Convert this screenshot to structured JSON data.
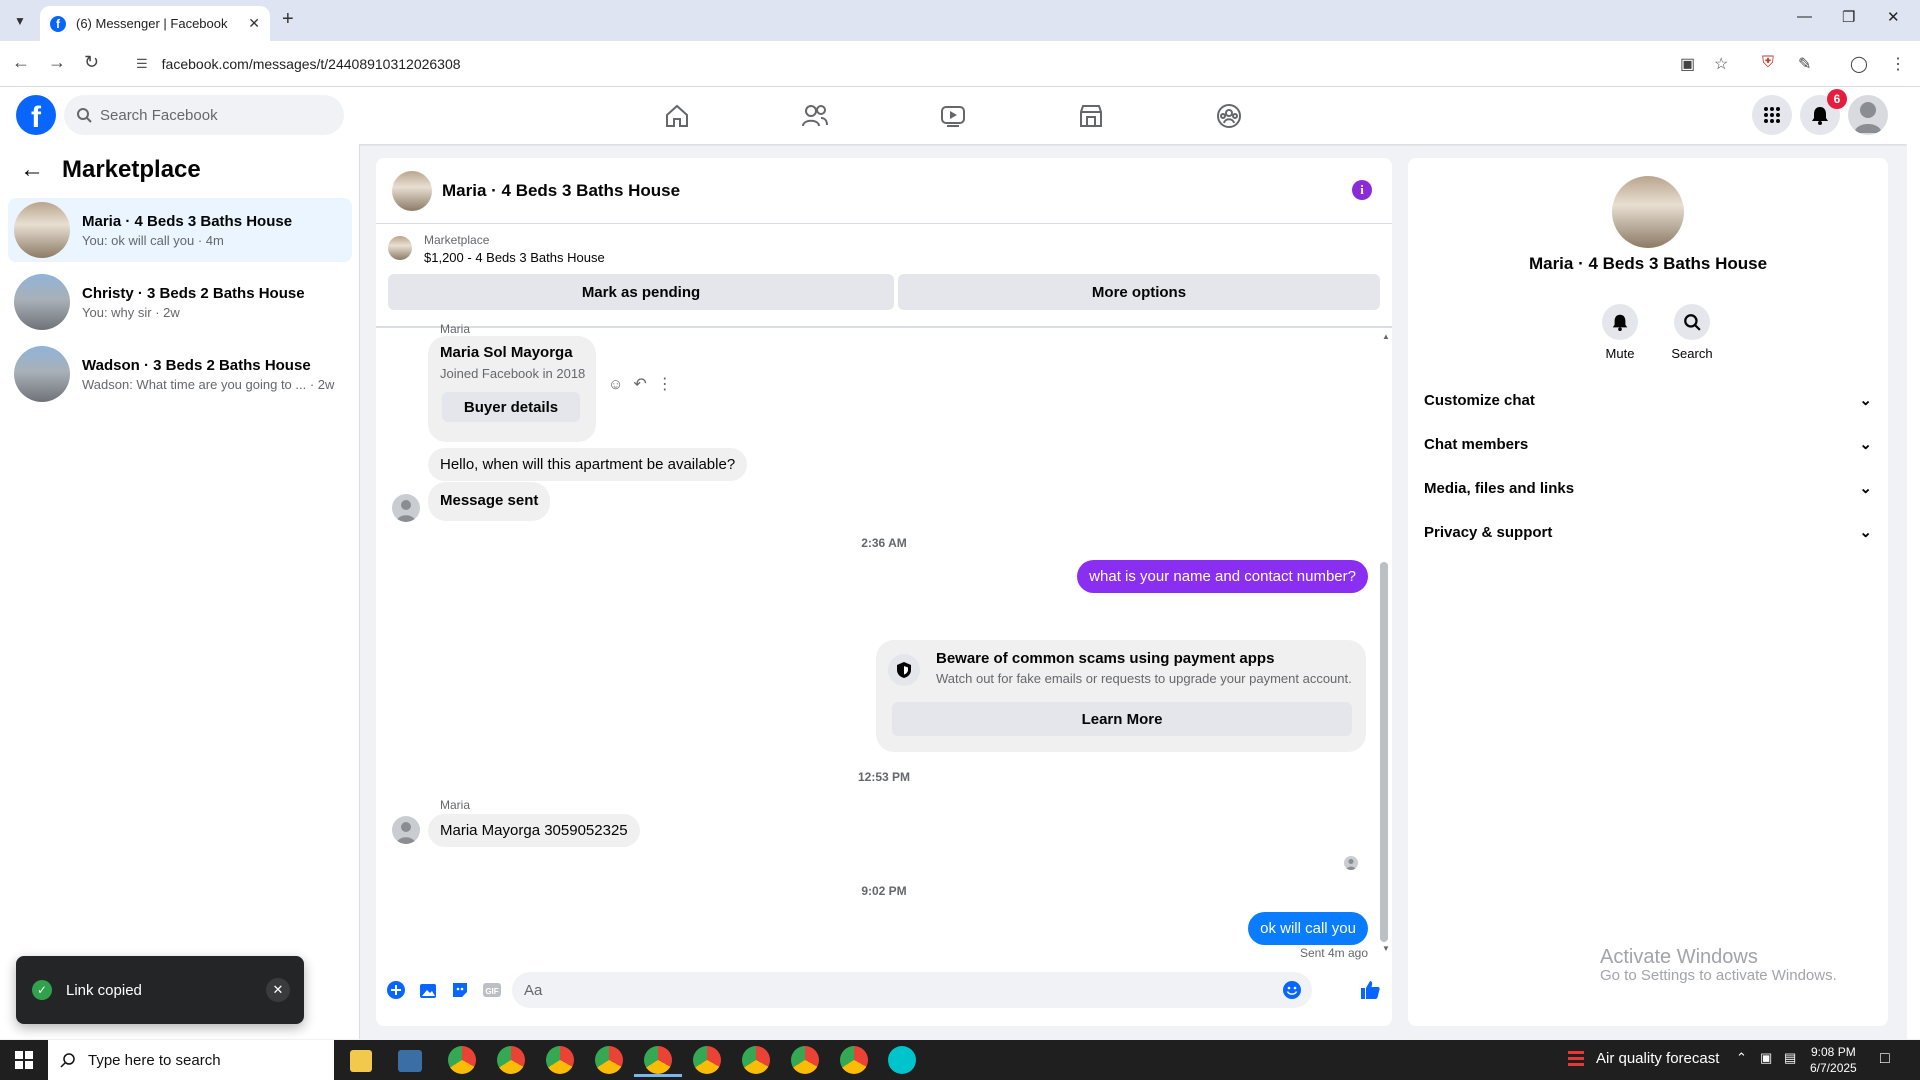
{
  "browser": {
    "tab_title": "(6) Messenger | Facebook",
    "url": "facebook.com/messages/t/24408910312026308"
  },
  "header": {
    "search_placeholder": "Search Facebook",
    "notification_count": "6",
    "nav_icons": [
      "home-icon",
      "friends-icon",
      "video-icon",
      "marketplace-icon",
      "groups-icon"
    ]
  },
  "sidebar": {
    "title": "Marketplace",
    "conversations": [
      {
        "name": "Maria · 4 Beds 3 Baths House",
        "snippet": "You: ok will call you · 4m"
      },
      {
        "name": "Christy · 3 Beds 2 Baths House",
        "snippet": "You: why sir · 2w"
      },
      {
        "name": "Wadson · 3 Beds 2 Baths House",
        "snippet": "Wadson: What time are you going to ... · 2w"
      }
    ]
  },
  "chat": {
    "title": "Maria · 4 Beds 3 Baths House",
    "listing": {
      "label": "Marketplace",
      "price_line": "$1,200 - 4 Beds 3 Baths House",
      "mark_pending": "Mark as pending",
      "more_options": "More options"
    },
    "buyer_card": {
      "sender": "Maria",
      "name": "Maria Sol Mayorga",
      "joined": "Joined Facebook in 2018",
      "button": "Buyer details"
    },
    "messages": {
      "m1": "Hello, when will this apartment be available?",
      "m2": "Message sent",
      "ts1": "2:36 AM",
      "m3": "what is your name and contact number?",
      "ts2": "12:53 PM",
      "m4_sender": "Maria",
      "m4": "Maria Mayorga 3059052325",
      "ts3": "9:02 PM",
      "m5": "ok will call you",
      "sent_status": "Sent 4m ago"
    },
    "scam_notice": {
      "title": "Beware of common scams using payment apps",
      "desc": "Watch out for fake emails or requests to upgrade your payment account.",
      "button": "Learn More"
    },
    "composer_placeholder": "Aa"
  },
  "info_panel": {
    "name": "Maria · 4 Beds 3 Baths House",
    "mute": "Mute",
    "search": "Search",
    "sections": [
      "Customize chat",
      "Chat members",
      "Media, files and links",
      "Privacy & support"
    ]
  },
  "watermark": {
    "line1": "Activate Windows",
    "line2": "Go to Settings to activate Windows."
  },
  "toast": {
    "text": "Link copied"
  },
  "taskbar": {
    "search_placeholder": "Type here to search",
    "weather": "Air quality forecast",
    "time": "9:08 PM",
    "date": "6/7/2025"
  },
  "colors": {
    "fb_blue": "#0866ff",
    "outgoing_purple": "#8a2ef2",
    "outgoing_blue": "#0a7cff",
    "selected_conv": "#ebf5ff"
  }
}
